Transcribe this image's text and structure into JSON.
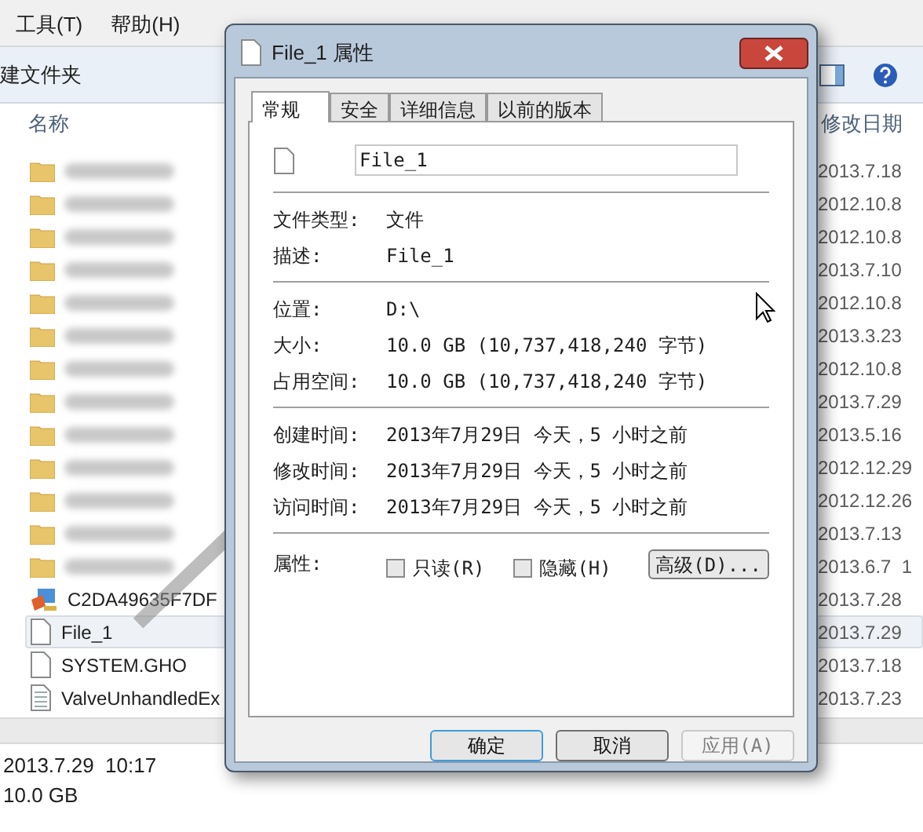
{
  "menu": [
    "工具(T)",
    "帮助(H)"
  ],
  "toolbar": {
    "new_folder": "建文件夹"
  },
  "columns": [
    "名称",
    "修改日期"
  ],
  "files": [
    {
      "kind": "blurred_folder",
      "date": "2013.7.18",
      "selected": false
    },
    {
      "kind": "blurred_folder",
      "date": "2012.10.8",
      "selected": false
    },
    {
      "kind": "blurred_folder",
      "date": "2012.10.8",
      "selected": false
    },
    {
      "kind": "blurred_folder",
      "date": "2013.7.10",
      "selected": false
    },
    {
      "kind": "blurred_folder",
      "date": "2012.10.8",
      "selected": false
    },
    {
      "kind": "blurred_folder",
      "date": "2013.3.23",
      "selected": false
    },
    {
      "kind": "blurred_folder",
      "date": "2012.10.8",
      "selected": false
    },
    {
      "kind": "blurred_folder",
      "date": "2013.7.29",
      "selected": false
    },
    {
      "kind": "blurred_folder",
      "date": "2013.5.16",
      "selected": false
    },
    {
      "kind": "blurred_folder",
      "date": "2012.12.29",
      "selected": false
    },
    {
      "kind": "blurred_folder",
      "date": "2012.12.26",
      "selected": false
    },
    {
      "kind": "blurred_folder",
      "date": "2013.7.13",
      "selected": false
    },
    {
      "kind": "blurred_folder",
      "date": "2013.6.7  1",
      "selected": false
    },
    {
      "kind": "installer",
      "name": "C2DA49635F7DF",
      "date": "2013.7.28",
      "selected": false
    },
    {
      "kind": "file",
      "name": "File_1",
      "date": "2013.7.29",
      "selected": true
    },
    {
      "kind": "file",
      "name": "SYSTEM.GHO",
      "date": "2013.7.18",
      "selected": false
    },
    {
      "kind": "text_file",
      "name": "ValveUnhandledEx",
      "date": "2013.7.23",
      "selected": false
    }
  ],
  "status_bar": [
    "2013.7.29  10:17",
    "10.0 GB"
  ],
  "dialog": {
    "title": "File_1 属性",
    "tabs": [
      {
        "label": "常规",
        "selected": true
      },
      {
        "label": "安全",
        "selected": false
      },
      {
        "label": "详细信息",
        "selected": false
      },
      {
        "label": "以前的版本",
        "selected": false
      }
    ],
    "name_field": "File_1",
    "sections": [
      [
        {
          "label": "文件类型:",
          "value": "文件"
        },
        {
          "label": "描述:",
          "value": "File_1"
        }
      ],
      [
        {
          "label": "位置:",
          "value": "D:\\"
        },
        {
          "label": "大小:",
          "value": "10.0 GB (10,737,418,240 字节)"
        },
        {
          "label": "占用空间:",
          "value": "10.0 GB (10,737,418,240 字节)"
        }
      ],
      [
        {
          "label": "创建时间:",
          "value": "2013年7月29日 今天，5 小时之前"
        },
        {
          "label": "修改时间:",
          "value": "2013年7月29日 今天，5 小时之前"
        },
        {
          "label": "访问时间:",
          "value": "2013年7月29日 今天，5 小时之前"
        }
      ]
    ],
    "attributes_label": "属性:",
    "attributes": [
      {
        "label": "只读(R)",
        "checked": false
      },
      {
        "label": "隐藏(H)",
        "checked": false
      }
    ],
    "advanced_button": "高级(D)...",
    "buttons": [
      {
        "label": "确定",
        "default": true,
        "disabled": false
      },
      {
        "label": "取消",
        "default": false,
        "disabled": false
      },
      {
        "label": "应用(A)",
        "default": false,
        "disabled": true
      }
    ]
  }
}
